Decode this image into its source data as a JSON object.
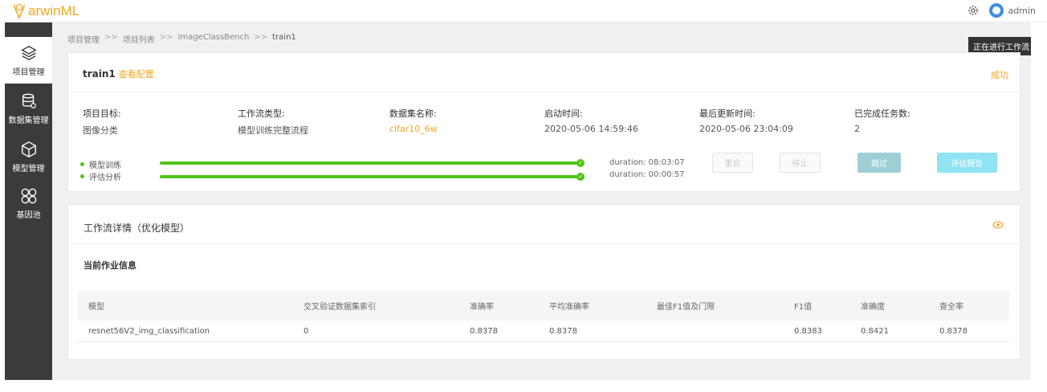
{
  "app": {
    "logo_text": "arwinML"
  },
  "header": {
    "username": "admin"
  },
  "sidebar": {
    "items": [
      {
        "label": "项目管理",
        "icon": "layers-icon"
      },
      {
        "label": "数据集管理",
        "icon": "database-icon"
      },
      {
        "label": "模型管理",
        "icon": "cube-icon"
      },
      {
        "label": "基因池",
        "icon": "gene-pool-icon"
      }
    ]
  },
  "breadcrumb": {
    "items": [
      "项目管理",
      "项目列表",
      "ImageClassBench",
      "train1"
    ],
    "separator": ">>"
  },
  "tooltip": {
    "text": "正在进行工作流"
  },
  "job": {
    "name": "train1",
    "view_config_label": "查看配置",
    "status": "成功",
    "fields": [
      {
        "label": "项目目标:",
        "value": "图像分类"
      },
      {
        "label": "工作流类型:",
        "value": "模型训练完整流程"
      },
      {
        "label": "数据集名称:",
        "value": "cifar10_6w"
      },
      {
        "label": "启动时间:",
        "value": "2020-05-06 14:59:46"
      },
      {
        "label": "最后更新时间:",
        "value": "2020-05-06 23:04:09"
      },
      {
        "label": "已完成任务数:",
        "value": "2"
      }
    ],
    "stages": [
      {
        "name": "模型训练",
        "duration": "duration: 08:03:07",
        "progress": 1.0
      },
      {
        "name": "评估分析",
        "duration": "duration: 00:00:57",
        "progress": 1.0
      }
    ],
    "buttons": {
      "restart": "重启",
      "stop": "停止",
      "skip": "跳过",
      "report": "评估报告"
    }
  },
  "workflow": {
    "title": "工作流详情（优化模型）",
    "current_job_title": "当前作业信息",
    "columns": [
      "模型",
      "交叉验证数据集索引",
      "准确率",
      "平均准确率",
      "最佳F1值及门限",
      "F1值",
      "准确度",
      "查全率"
    ],
    "rows": [
      [
        "resnet56V2_img_classification",
        "0",
        "0.8378",
        "0.8378",
        "",
        "0.8383",
        "0.8421",
        "0.8378"
      ]
    ]
  },
  "colors": {
    "accent": "#f5a623",
    "success": "#52c41a",
    "sidebar": "#3b3b3b"
  }
}
